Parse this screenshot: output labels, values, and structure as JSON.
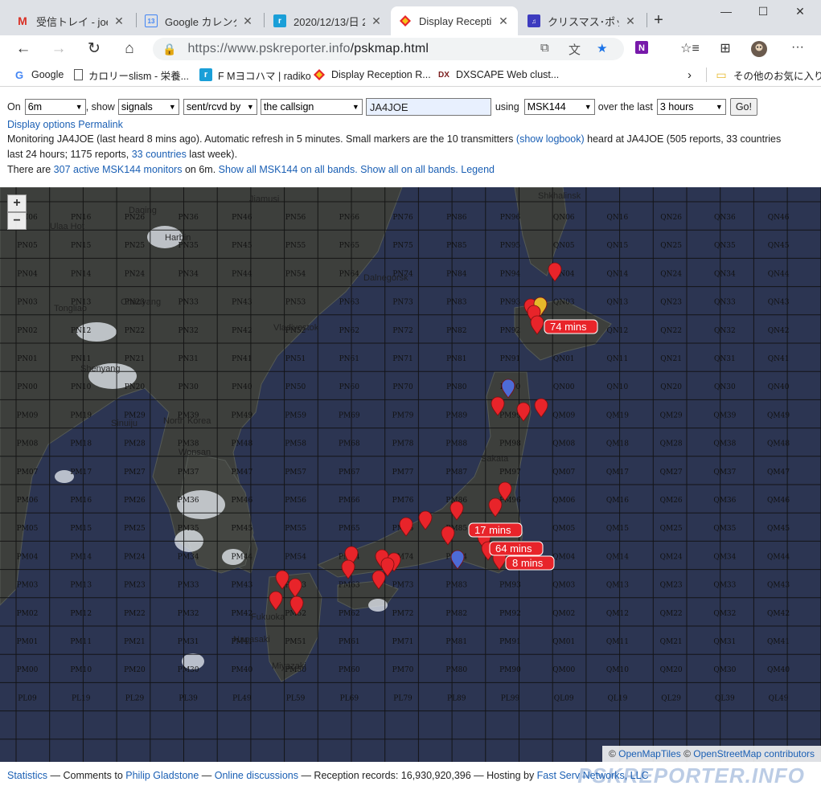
{
  "tabs": [
    {
      "title": "受信トレイ - joe.on",
      "icon": "gmail-icon"
    },
    {
      "title": "Google カレンダー -",
      "icon": "calendar-icon"
    },
    {
      "title": "2020/12/13/日 21",
      "icon": "radiko-icon"
    },
    {
      "title": "Display Reception",
      "icon": "pskreporter-icon"
    },
    {
      "title": "クリスマス･ポップス",
      "icon": "music-icon"
    }
  ],
  "browser": {
    "url_host": "https://www.pskreporter.info",
    "url_path": "/pskmap.html"
  },
  "bookmarks": [
    {
      "label": "Google"
    },
    {
      "label": "カロリーslism - 栄養..."
    },
    {
      "label": "F Mヨコハマ | radiko"
    },
    {
      "label": "Display Reception R..."
    },
    {
      "label": "DXSCAPE Web clust..."
    },
    {
      "label": "その他のお気に入り"
    }
  ],
  "controls": {
    "on_label": "On",
    "band": "6m",
    "show_label": ", show",
    "show": "signals",
    "direction": "sent/rcvd by",
    "target": "the callsign",
    "callsign": "JA4JOE",
    "using_label": "using",
    "mode": "MSK144",
    "over_label": "over the last",
    "period": "3 hours",
    "go": "Go!",
    "display_options": "Display options",
    "permalink": "Permalink"
  },
  "info": {
    "line1_a": "Monitoring JA4JOE (last heard 8 mins ago). Automatic refresh in 5 minutes. Small markers are the 10 transmitters ",
    "show_logbook": "(show logbook)",
    "line1_b": " heard at JA4JOE (505 reports, 33 countries",
    "line2_a": "last 24 hours; 1175 reports, ",
    "countries_link": "33 countries",
    "line2_b": " last week).",
    "line3_a": "There are ",
    "monitors_link": "307 active MSK144 monitors",
    "line3_b": " on 6m. ",
    "show_all_bands": "Show all MSK144 on all bands.",
    "show_all": "Show all on all bands.",
    "legend": "Legend"
  },
  "map": {
    "zoom_in": "+",
    "zoom_out": "−",
    "callouts": [
      "74 mins",
      "17 mins",
      "64 mins",
      "8 mins"
    ],
    "places": [
      "Jiamusi",
      "Shkhalinsk",
      "Daqing",
      "Ulaa Hot",
      "Harbin",
      "Dalnegorsk",
      "Tongliao",
      "Chaoyang",
      "Vladivostok",
      "Shenyang",
      "North Korea",
      "Sinuiju",
      "Wonsan",
      "Sakata",
      "Fukuoka",
      "Nagasaki",
      "Miyazaki"
    ],
    "grid_lat": [
      "06",
      "05",
      "04",
      "03",
      "02",
      "01",
      "00",
      "99",
      "98",
      "97",
      "96",
      "95",
      "94",
      "93",
      "92",
      "91",
      "90",
      "89"
    ],
    "attribution_tiles": "OpenMapTiles",
    "attribution_osm": "OpenStreetMap contributors"
  },
  "footer": {
    "statistics": "Statistics",
    "dash1": " — Comments to ",
    "author": "Philip Gladstone",
    "dash2": " — ",
    "discussions": "Online discussions",
    "records": " — Reception records: 16,930,920,396 — Hosting by ",
    "host": "Fast Serv Networks, LLC",
    "watermark": "PSKREPORTER.INFO"
  },
  "colors": {
    "marker": "#e8242a",
    "marker_blue": "#4d6bd6",
    "marker_yellow": "#e6b82a",
    "link": "#1a5fb4",
    "sea": "#2c3552"
  }
}
